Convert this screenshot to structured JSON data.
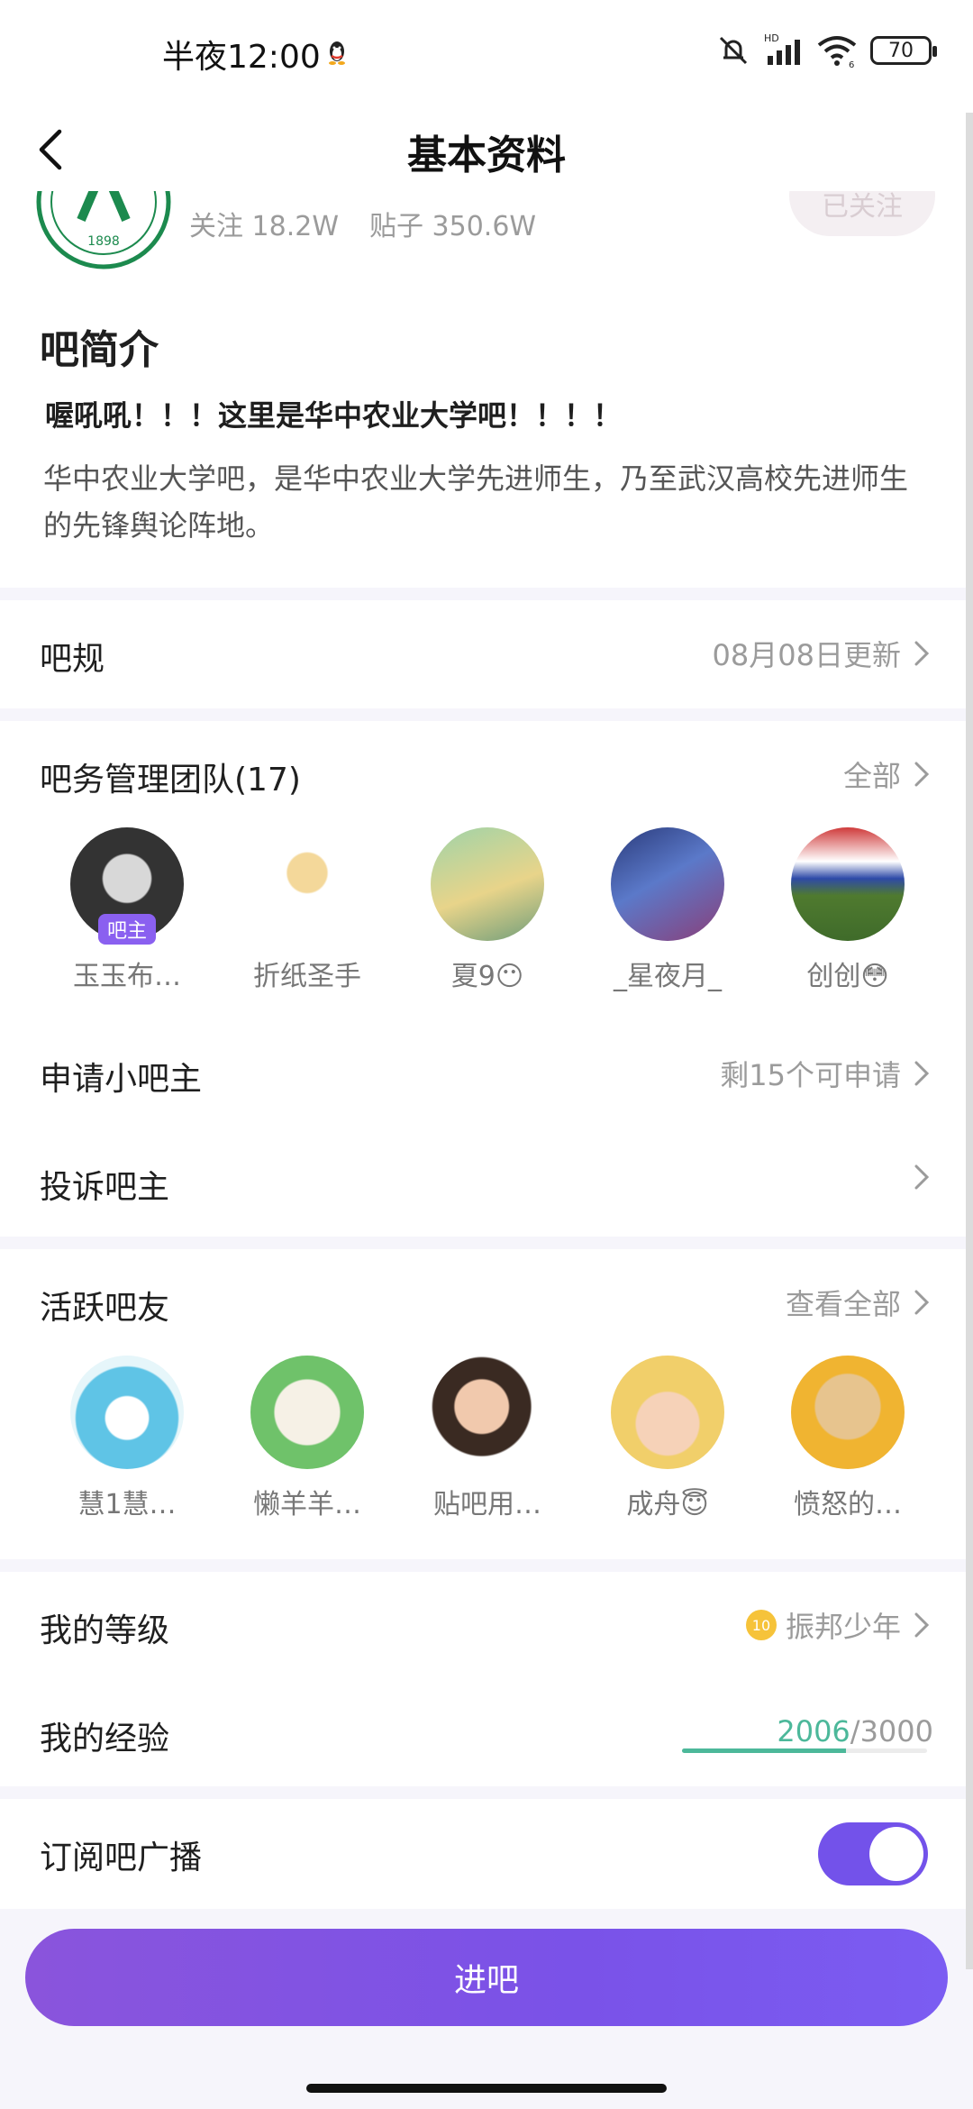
{
  "status_bar": {
    "time": "半夜12:00",
    "hd_label": "HD",
    "wifi_label": "6",
    "battery": "70"
  },
  "nav": {
    "title": "基本资料"
  },
  "forum": {
    "follows": "关注 18.2W",
    "posts": "贴子 350.6W",
    "follow_button": "已关注",
    "logo_text": "1898"
  },
  "intro": {
    "title": "吧简介",
    "headline": "喔吼吼！！！这里是华中农业大学吧！！！！",
    "body": "华中农业大学吧，是华中农业大学先进师生，乃至武汉高校先进师生的先锋舆论阵地。"
  },
  "rules": {
    "label": "吧规",
    "value": "08月08日更新"
  },
  "team": {
    "label": "吧务管理团队(17)",
    "more": "全部",
    "owner_tag": "吧主",
    "members": [
      {
        "name": "玉玉布…"
      },
      {
        "name": "折纸圣手"
      },
      {
        "name": "夏9😶"
      },
      {
        "name": "_星夜月_"
      },
      {
        "name": "创创😳"
      }
    ]
  },
  "apply": {
    "label": "申请小吧主",
    "value": "剩15个可申请"
  },
  "complain": {
    "label": "投诉吧主"
  },
  "active": {
    "label": "活跃吧友",
    "more": "查看全部",
    "members": [
      {
        "name": "慧1慧…"
      },
      {
        "name": "懒羊羊…"
      },
      {
        "name": "贴吧用…"
      },
      {
        "name": "成舟😇"
      },
      {
        "name": "愤怒的…"
      }
    ]
  },
  "level": {
    "label": "我的等级",
    "badge": "10",
    "value": "振邦少年"
  },
  "experience": {
    "label": "我的经验",
    "current": "2006",
    "separator": "/",
    "total": "3000",
    "progress": 0.669
  },
  "subscribe": {
    "label": "订阅吧广播",
    "enabled": true
  },
  "enter_button": "进吧",
  "colors": {
    "accent": "#7352ea",
    "progress": "#4cb89a"
  }
}
